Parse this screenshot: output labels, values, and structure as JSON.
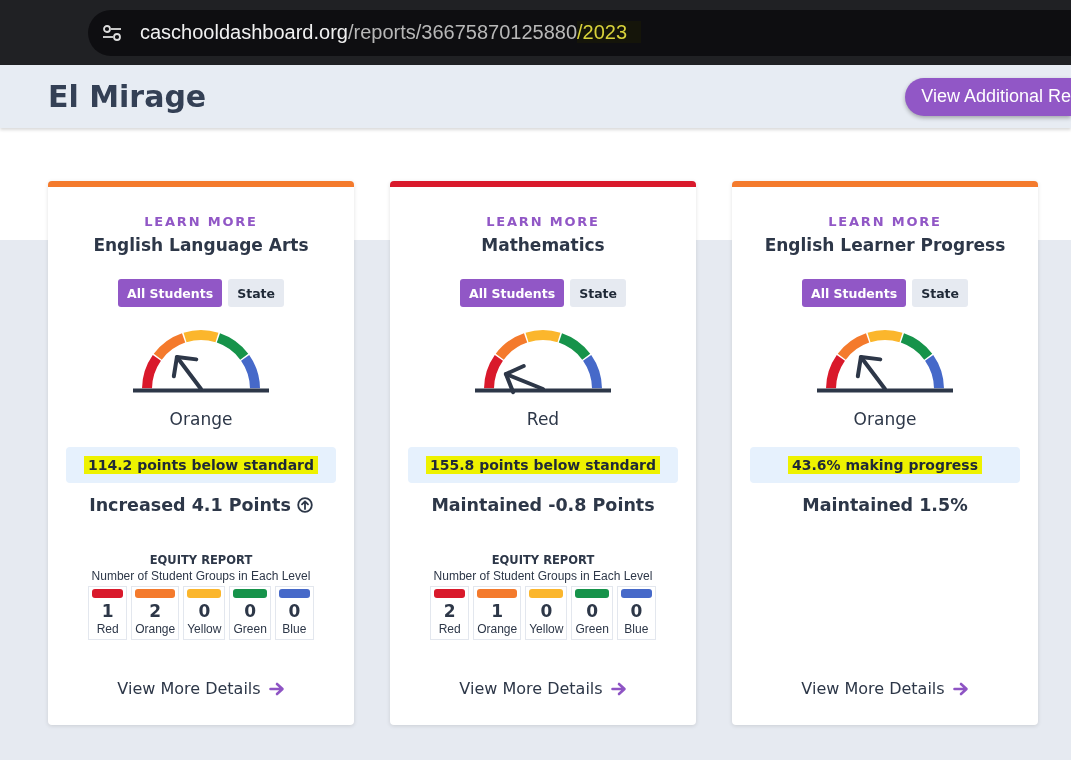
{
  "browser": {
    "url": [
      {
        "text": "caschooldashboard.org",
        "kind": "domain"
      },
      {
        "text": "/reports/36675870125880",
        "kind": "path"
      },
      {
        "text": "/2023",
        "kind": "marked"
      }
    ]
  },
  "header": {
    "title": "El Mirage",
    "button": "View Additional Re"
  },
  "cards": [
    {
      "learn_more": "LEARN MORE",
      "title": "English Language Arts",
      "color": "#f47a2c",
      "tabs": [
        {
          "label": "All Students",
          "selected": true
        },
        {
          "label": "State",
          "selected": false
        }
      ],
      "rating": "Orange",
      "status": {
        "text": "114.2 points below standard",
        "highlighted": true
      },
      "change": "Increased 4.1 Points",
      "increased": true,
      "equity": {
        "title": "EQUITY REPORT",
        "subtitle": "Number of Student Groups in Each Level",
        "levels": [
          {
            "count": "1",
            "label": "Red",
            "color": "#d9192b"
          },
          {
            "count": "2",
            "label": "Orange",
            "color": "#f47a2c"
          },
          {
            "count": "0",
            "label": "Yellow",
            "color": "#fbb62c"
          },
          {
            "count": "0",
            "label": "Green",
            "color": "#16934a"
          },
          {
            "count": "0",
            "label": "Blue",
            "color": "#4669c9"
          }
        ]
      },
      "details": "View More Details"
    },
    {
      "learn_more": "LEARN MORE",
      "title": "Mathematics",
      "color": "#d9192b",
      "tabs": [
        {
          "label": "All Students",
          "selected": true
        },
        {
          "label": "State",
          "selected": false
        }
      ],
      "rating": "Red",
      "status": {
        "text": "155.8 points below standard",
        "highlighted": true
      },
      "change": "Maintained -0.8 Points",
      "equity": {
        "title": "EQUITY REPORT",
        "subtitle": "Number of Student Groups in Each Level",
        "levels": [
          {
            "count": "2",
            "label": "Red",
            "color": "#d9192b"
          },
          {
            "count": "1",
            "label": "Orange",
            "color": "#f47a2c"
          },
          {
            "count": "0",
            "label": "Yellow",
            "color": "#fbb62c"
          },
          {
            "count": "0",
            "label": "Green",
            "color": "#16934a"
          },
          {
            "count": "0",
            "label": "Blue",
            "color": "#4669c9"
          }
        ]
      },
      "details": "View More Details"
    },
    {
      "learn_more": "LEARN MORE",
      "title": "English Learner Progress",
      "color": "#f47a2c",
      "tabs": [
        {
          "label": "All Students",
          "selected": true
        },
        {
          "label": "State",
          "selected": false
        }
      ],
      "rating": "Orange",
      "status": {
        "text": "43.6% making progress",
        "highlighted": true
      },
      "change": "Maintained 1.5%",
      "details": "View More Details"
    }
  ]
}
